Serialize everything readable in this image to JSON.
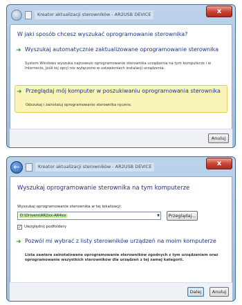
{
  "window1": {
    "title": "Kreator aktualizacji sterowników - AR2USB DEVICE",
    "close_glyph": "x",
    "heading": "W jaki sposób chcesz wyszukać oprogramowanie sterownika?",
    "option_auto": {
      "arrow": "➜",
      "title": "Wyszukaj automatycznie zaktualizowane oprogramowanie sterownika",
      "description": "System Windows wyszuka najnowsze oprogramowanie sterownika urządzenia na tym komputerze i w Internecie, jeśli tej opcji nie wyłączono w ustawieniach instalacji urządzenia."
    },
    "option_browse": {
      "arrow": "➜",
      "title": "Przeglądaj mój komputer w poszukiwaniu oprogramowania sterownika",
      "description": "Odszukaj i zainstaluj oprogramowanie sterownika ręcznie."
    },
    "cancel_label": "Anuluj"
  },
  "window2": {
    "title": "Kreator aktualizacji sterowników - AR2USB DEVICE",
    "close_glyph": "x",
    "back_glyph": "←",
    "heading": "Wyszukaj oprogramowanie sterownika na tym komputerze",
    "location_label": "Wyszukaj oprogramowanie sterownika w tej lokalizacji:",
    "path_value": "D:\\Drivers\\AR2xx-AR4xx",
    "dropdown_arrow": "▼",
    "browse_label": "Przeglądaj...",
    "include_subfolders_label": "Uwzględnij podfoldery",
    "include_subfolders_checked": true,
    "checkmark": "✓",
    "option_pick": {
      "arrow": "➜",
      "title": "Pozwól mi wybrać z listy sterowników urządzeń na moim komputerze",
      "description": "Lista zawiera zainstalowane oprogramowanie sterowników zgodnych z tym urządzeniem oraz oprogramowanie wszystkich sterowników dla urządzeń z tej samej kategorii."
    },
    "next_label": "Dalej",
    "cancel_label": "Anuluj"
  },
  "colors": {
    "link_blue": "#1e3287",
    "highlight_yellow": "#fbf4b8",
    "path_selection_green": "#c6ee9f",
    "arrow_green": "#2f9a3b",
    "close_red": "#c9473a"
  }
}
